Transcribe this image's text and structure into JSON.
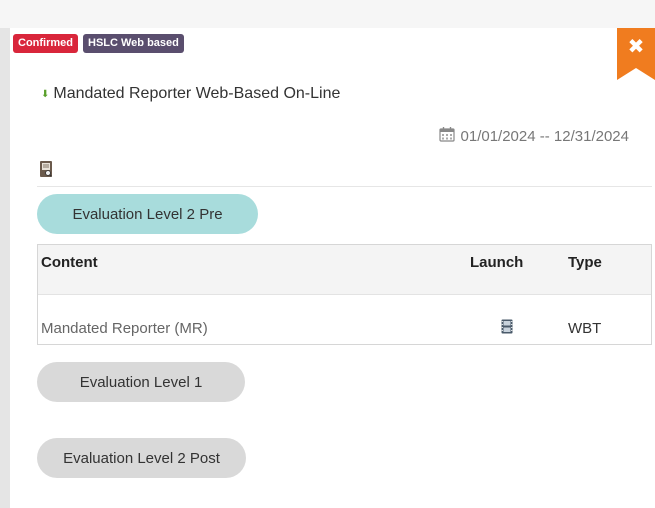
{
  "badges": {
    "confirmed": "Confirmed",
    "delivery": "HSLC Web based"
  },
  "close": {
    "glyph": "✖",
    "icon": "close-icon"
  },
  "course": {
    "title": "Mandated Reporter Web-Based On-Line",
    "date_range": "01/01/2024 -- 12/31/2024"
  },
  "evaluations": {
    "pre": "Evaluation Level 2 Pre",
    "level1": "Evaluation Level 1",
    "post": "Evaluation Level 2 Post"
  },
  "table": {
    "headers": {
      "content": "Content",
      "launch": "Launch",
      "type": "Type"
    },
    "rows": [
      {
        "content": "Mandated Reporter (MR)",
        "launch_icon": "film-icon",
        "type": "WBT"
      }
    ]
  },
  "colors": {
    "confirmed": "#d9263b",
    "delivery": "#5a4e6e",
    "ribbon": "#f07c1f",
    "active_pill": "#a8dcdc",
    "pill": "#d9d9d9",
    "arrow": "#5aa02c"
  }
}
